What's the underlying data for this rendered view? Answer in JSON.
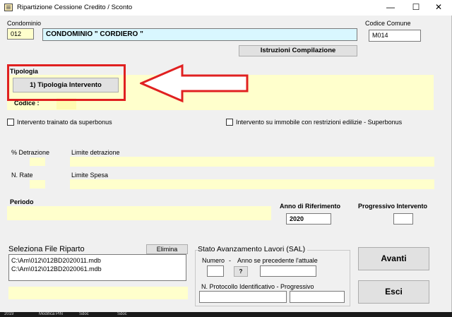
{
  "window": {
    "title": "Ripartizione Cessione Credito / Sconto",
    "minimize_glyph": "—",
    "maximize_glyph": "☐",
    "close_glyph": "✕"
  },
  "condominio": {
    "label": "Condominio",
    "code": "012",
    "name": "CONDOMINIO \" CORDIERO \""
  },
  "codice_comune": {
    "label": "Codice Comune",
    "value": "M014"
  },
  "istruzioni_button": "Istruzioni Compilazione",
  "tipologia": {
    "label": "Tipologia",
    "button": "1) Tipologia Intervento",
    "codice_label": "Codice :"
  },
  "annotation": {
    "color": "#e02020"
  },
  "checkboxes": {
    "trainato": "Intervento trainato da superbonus",
    "restrizioni": "Intervento su immobile con restrizioni edilizie  - Superbonus"
  },
  "detrazione": {
    "percent_label": "% Detrazione",
    "limite_label": "Limite detrazione",
    "rate_label": "N. Rate",
    "limite_spesa_label": "Limite Spesa"
  },
  "periodo": {
    "label": "Periodo"
  },
  "anno": {
    "label": "Anno di Riferimento",
    "value": "2020"
  },
  "progressivo": {
    "label": "Progressivo Intervento",
    "value": ""
  },
  "file_riparto": {
    "label": "Seleziona File Riparto",
    "elimina": "Elimina",
    "files": [
      "C:\\Am\\012\\012BD2020011.mdb",
      "C:\\Am\\012\\012BD2020061.mdb"
    ]
  },
  "sal": {
    "title": "Stato Avanzamento Lavori (SAL)",
    "numero_label": "Numero",
    "sep": "-",
    "anno_label": "Anno se precedente l'attuale",
    "help_button": "?",
    "protocollo_label": "N. Protocollo Identificativo - Progressivo"
  },
  "buttons": {
    "avanti": "Avanti",
    "esci": "Esci"
  },
  "statusbar": [
    "2019",
    "Modifica PIN",
    "Sdoc",
    "Sdoc"
  ],
  "colors": {
    "field_yellow": "#ffffcc",
    "highlight_cyan": "#d9f7ff"
  }
}
